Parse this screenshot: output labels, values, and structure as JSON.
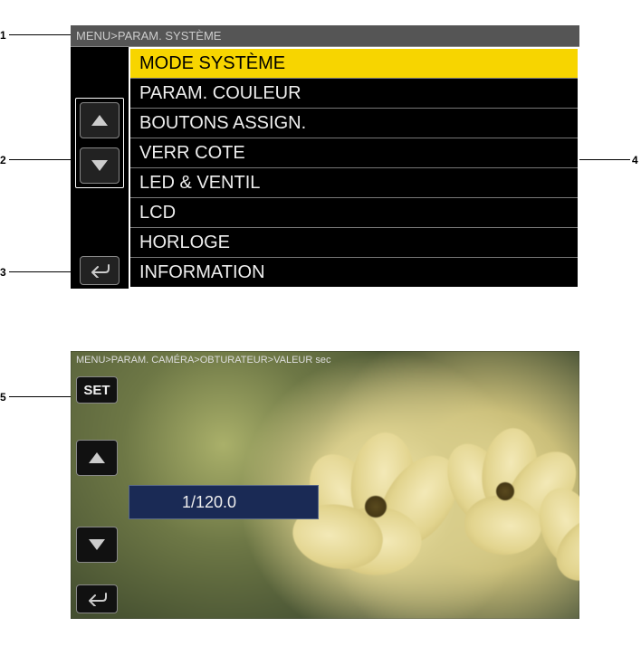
{
  "callouts": {
    "c1": "1",
    "c2": "2",
    "c3": "3",
    "c4": "4",
    "c5": "5"
  },
  "screen1": {
    "breadcrumb": "MENU>PARAM. SYSTÈME",
    "items": [
      "MODE SYSTÈME",
      "PARAM. COULEUR",
      "BOUTONS ASSIGN.",
      "VERR COTE",
      "LED & VENTIL",
      "LCD",
      "HORLOGE",
      "INFORMATION"
    ]
  },
  "screen2": {
    "breadcrumb": "MENU>PARAM. CAMÉRA>OBTURATEUR>VALEUR sec",
    "set_label": "SET",
    "value": "1/120.0"
  }
}
